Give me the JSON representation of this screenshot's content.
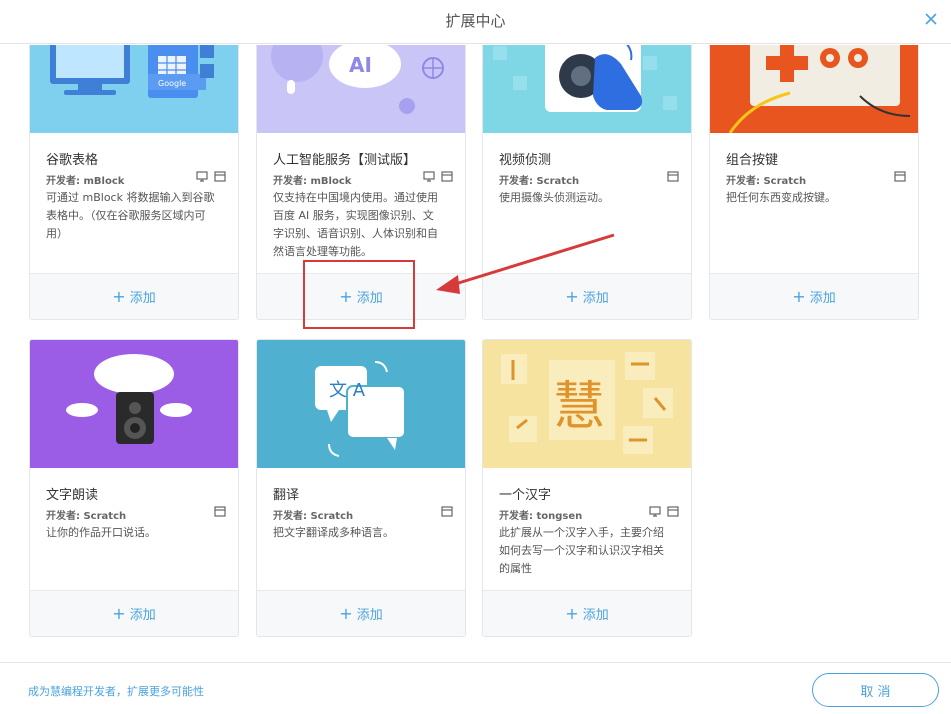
{
  "dialog": {
    "title": "扩展中心",
    "bottom_link": "成为慧编程开发者，扩展更多可能性",
    "cancel_label": "取 消"
  },
  "cards": [
    {
      "name": "谷歌表格",
      "developer": "开发者: mBlock",
      "desc_lines": [
        "可通过 mBlock 将数据输入到谷歌",
        "表格中。（仅在谷歌服务区域内可",
        "用）"
      ],
      "add_label": "添加",
      "thumb_label": "Google",
      "icons": [
        "monitor-icon",
        "window-icon"
      ],
      "colors": {
        "thumb": "#7fd0ef"
      }
    },
    {
      "name": "人工智能服务【测试版】",
      "developer": "开发者: mBlock",
      "desc_lines": [
        "仅支持在中国境内使用。通过使用",
        "百度 AI 服务，实现图像识别、文",
        "字识别、语音识别、人体识别和自",
        "然语言处理等功能。"
      ],
      "add_label": "添加",
      "thumb_label": "AI",
      "icons": [
        "monitor-icon",
        "window-icon"
      ],
      "colors": {
        "thumb": "#c9c6f7"
      }
    },
    {
      "name": "视频侦测",
      "developer": "开发者: Scratch",
      "desc_lines": [
        "使用摄像头侦测运动。"
      ],
      "add_label": "添加",
      "icons": [
        "window-icon"
      ],
      "colors": {
        "thumb": "#7fd7e6"
      }
    },
    {
      "name": "组合按键",
      "developer": "开发者: Scratch",
      "desc_lines": [
        "把任何东西变成按键。"
      ],
      "add_label": "添加",
      "icons": [
        "window-icon"
      ],
      "colors": {
        "thumb": "#e8551f"
      }
    },
    {
      "name": "文字朗读",
      "developer": "开发者: Scratch",
      "desc_lines": [
        "让你的作品开口说话。"
      ],
      "add_label": "添加",
      "icons": [
        "window-icon"
      ],
      "colors": {
        "thumb": "#9b5de5"
      }
    },
    {
      "name": "翻译",
      "developer": "开发者: Scratch",
      "desc_lines": [
        "把文字翻译成多种语言。"
      ],
      "add_label": "添加",
      "thumb_label": "文 A",
      "icons": [
        "window-icon"
      ],
      "colors": {
        "thumb": "#4fb0cf"
      }
    },
    {
      "name": "一个汉字",
      "developer": "开发者: tongsen",
      "desc_lines": [
        "此扩展从一个汉字入手，主要介绍",
        "如何去写一个汉字和认识汉字相关",
        "的属性"
      ],
      "add_label": "添加",
      "thumb_label": "慧",
      "icons": [
        "monitor-icon",
        "window-icon"
      ],
      "colors": {
        "thumb": "#f6e3a0"
      }
    }
  ],
  "colors": {
    "accent": "#4aa3df",
    "annotation": "#d63a3a"
  }
}
